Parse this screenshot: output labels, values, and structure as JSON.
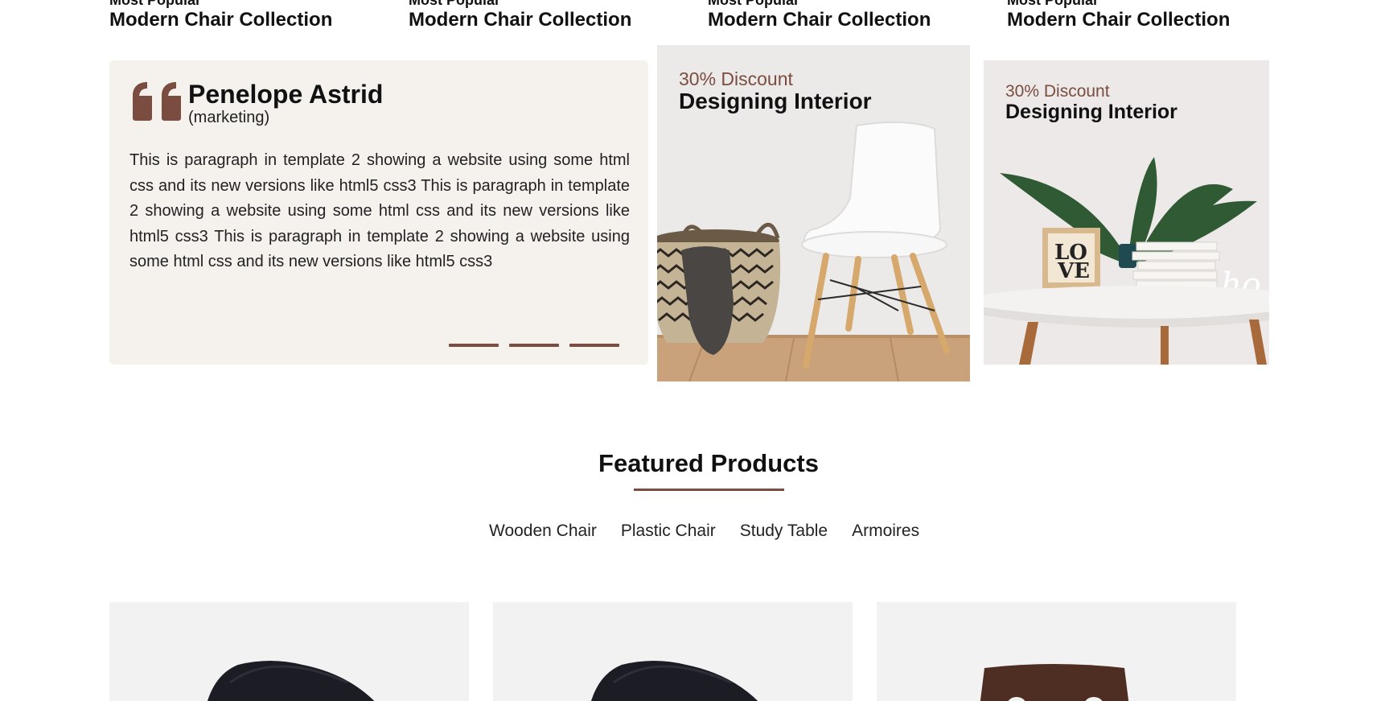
{
  "collections": [
    {
      "kicker": "Most Popular",
      "title": "Modern Chair Collection"
    },
    {
      "kicker": "Most Popular",
      "title": "Modern Chair Collection"
    },
    {
      "kicker": "Most Popular",
      "title": "Modern Chair Collection"
    },
    {
      "kicker": "Most Popular",
      "title": "Modern Chair Collection"
    }
  ],
  "testimonial": {
    "name": "Penelope Astrid",
    "role": "(marketing)",
    "text": "This is paragraph in template 2 showing a website using some html css and its new versions like html5 css3 This is paragraph in template 2 showing a website using some html css and its new versions like html5 css3 This is paragraph in template 2 showing a website using some html css and its new versions like html5 css3",
    "slide_count": 3
  },
  "promos": [
    {
      "discount": "30% Discount",
      "title": "Designing Interior"
    },
    {
      "discount": "30% Discount",
      "title": "Designing Interior"
    }
  ],
  "featured": {
    "title": "Featured Products",
    "tabs": [
      "Wooden Chair",
      "Plastic Chair",
      "Study Table",
      "Armoires"
    ]
  },
  "colors": {
    "accent": "#7a4d40",
    "testimonial_bg": "#f5f2ee",
    "product_bg": "#f2f2f2"
  },
  "icons": [
    "quote-icon"
  ]
}
